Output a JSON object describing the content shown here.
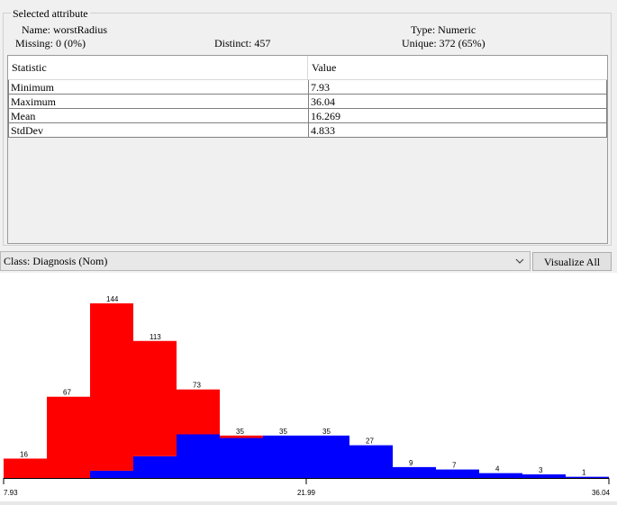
{
  "selected_attribute": {
    "group_title": "Selected attribute",
    "name_label": "Name:",
    "name_value": "worstRadius",
    "missing_label": "Missing:",
    "missing_value": "0 (0%)",
    "distinct_label": "Distinct:",
    "distinct_value": "457",
    "type_label": "Type:",
    "type_value": "Numeric",
    "unique_label": "Unique:",
    "unique_value": "372 (65%)"
  },
  "stats_table": {
    "headers": [
      "Statistic",
      "Value"
    ],
    "rows": [
      {
        "statistic": "Minimum",
        "value": "7.93"
      },
      {
        "statistic": "Maximum",
        "value": "36.04"
      },
      {
        "statistic": "Mean",
        "value": "16.269"
      },
      {
        "statistic": "StdDev",
        "value": "4.833"
      }
    ]
  },
  "class_selector": {
    "selected": "Class: Diagnosis (Nom)"
  },
  "visualize_button": {
    "label": "Visualize All"
  },
  "colors": {
    "series_red": "#ff0000",
    "series_blue": "#0000ff"
  },
  "chart_data": {
    "type": "bar",
    "x_min_label": "7.93",
    "x_mid_label": "21.99",
    "x_max_label": "36.04",
    "bins": 14,
    "totals": [
      16,
      67,
      144,
      113,
      73,
      35,
      35,
      35,
      27,
      9,
      7,
      4,
      3,
      1
    ],
    "series": [
      {
        "color": "red",
        "values": [
          16,
          67,
          138,
          95,
          37,
          2,
          0,
          0,
          0,
          0,
          0,
          0,
          0,
          0
        ]
      },
      {
        "color": "blue",
        "values": [
          0,
          0,
          6,
          18,
          36,
          33,
          35,
          35,
          27,
          9,
          7,
          4,
          3,
          1
        ]
      }
    ],
    "ylim": [
      0,
      144
    ]
  }
}
